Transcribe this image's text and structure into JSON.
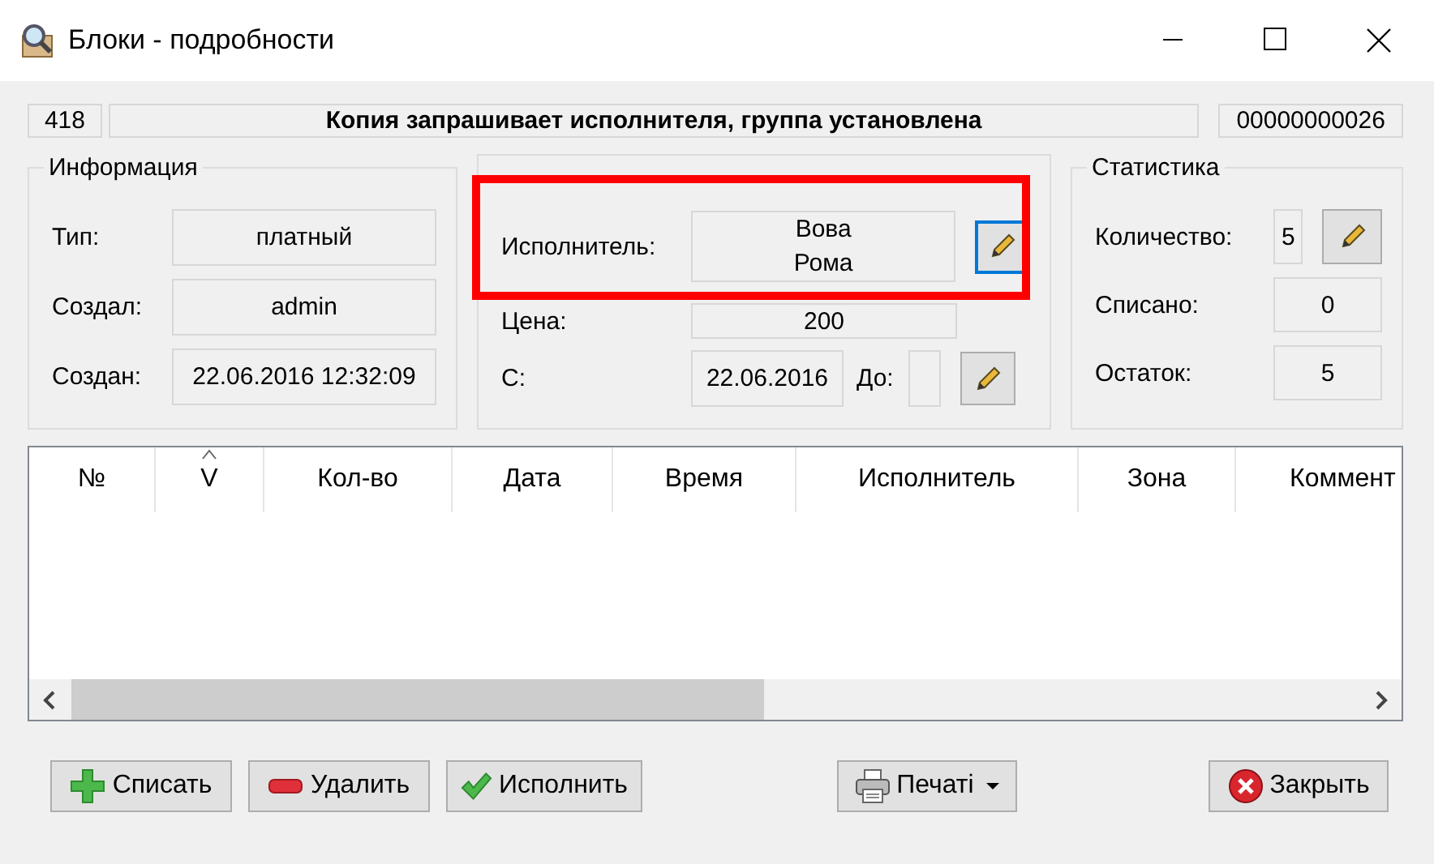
{
  "window": {
    "title": "Блоки - подробности"
  },
  "header": {
    "id": "418",
    "status": "Копия запрашивает исполнителя, группа установлена",
    "number": "00000000026"
  },
  "info": {
    "title": "Информация",
    "fields": [
      {
        "label": "Тип:",
        "value": "платный"
      },
      {
        "label": "Создал:",
        "value": "admin"
      },
      {
        "label": "Создан:",
        "value": "22.06.2016 12:32:09"
      }
    ]
  },
  "params": {
    "performer": {
      "label": "Исполнитель:",
      "value": "Вова\nРома",
      "edit_focused": true
    },
    "price": {
      "label": "Цена:",
      "value": "200"
    },
    "from": {
      "label": "С:",
      "value": "22.06.2016"
    },
    "to": {
      "label": "До:"
    }
  },
  "stats": {
    "title": "Статистика",
    "fields": [
      {
        "label": "Количество:",
        "value": "5",
        "editable": true
      },
      {
        "label": "Списано:",
        "value": "0",
        "editable": false
      },
      {
        "label": "Остаток:",
        "value": "5",
        "editable": false
      }
    ]
  },
  "table": {
    "columns": [
      {
        "label": "№",
        "sorted": false
      },
      {
        "label": "V",
        "sorted": true
      },
      {
        "label": "Кол-во",
        "sorted": false
      },
      {
        "label": "Дата",
        "sorted": false
      },
      {
        "label": "Время",
        "sorted": false
      },
      {
        "label": "Исполнитель",
        "sorted": false
      },
      {
        "label": "Зона",
        "sorted": false
      },
      {
        "label": "Коммент",
        "sorted": false
      }
    ]
  },
  "buttons": [
    {
      "label": "Списать",
      "kind": "add",
      "dropdown": false
    },
    {
      "label": "Удалить",
      "kind": "remove",
      "dropdown": false
    },
    {
      "label": "Исполнить",
      "kind": "confirm",
      "dropdown": false
    },
    {
      "label": "Печаті",
      "kind": "print",
      "dropdown": true
    },
    {
      "label": "Закрыть",
      "kind": "close",
      "dropdown": false
    }
  ],
  "annotation": {
    "kind": "highlight"
  }
}
